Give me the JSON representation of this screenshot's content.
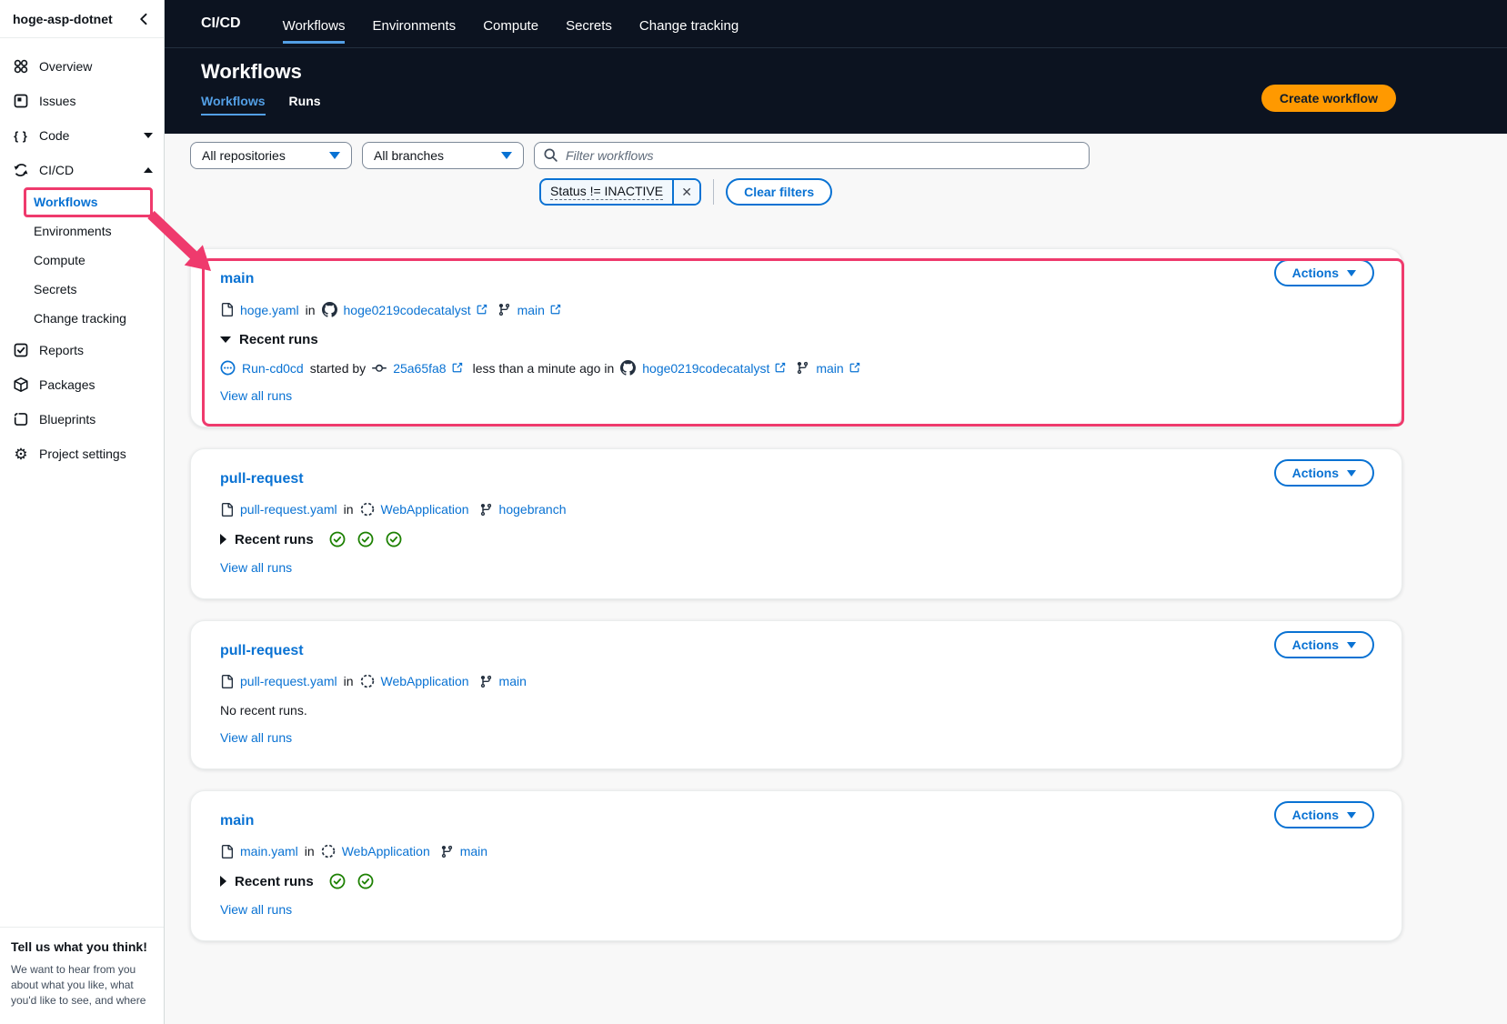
{
  "colors": {
    "accent_blue": "#0972d3",
    "active_tab_blue": "#539fe5",
    "dark_nav": "#0c1320",
    "primary_orange": "#ff9900",
    "success_green": "#1d8102",
    "annotation_pink": "#ef3a6d"
  },
  "icons": {
    "collapse": "chevron-left",
    "dropdown_caret": "filled-triangle-down",
    "token_close": "✕",
    "gear": "⚙",
    "code_braces": "{ }"
  },
  "sidebar": {
    "project_name": "hoge-asp-dotnet",
    "items": [
      "Overview",
      "Issues",
      "Code",
      "CI/CD",
      "Reports",
      "Packages",
      "Blueprints",
      "Project settings"
    ],
    "cicd_children": [
      "Workflows",
      "Environments",
      "Compute",
      "Secrets",
      "Change tracking"
    ],
    "active_child": "Workflows",
    "feedback_title": "Tell us what you think!",
    "feedback_body": "We want to hear from you about what you like, what you'd like to see, and where"
  },
  "topnav": {
    "section": "CI/CD",
    "items": [
      "Workflows",
      "Environments",
      "Compute",
      "Secrets",
      "Change tracking"
    ],
    "active": "Workflows"
  },
  "header": {
    "title": "Workflows",
    "tab_workflows": "Workflows",
    "tab_runs": "Runs",
    "create_button": "Create workflow"
  },
  "filters": {
    "repositories": "All repositories",
    "branches": "All branches",
    "search_placeholder": "Filter workflows",
    "token_label": "Status != INACTIVE",
    "clear_label": "Clear filters"
  },
  "common": {
    "recent_runs": "Recent runs",
    "view_all": "View all runs",
    "actions": "Actions",
    "in": "in",
    "no_recent": "No recent runs."
  },
  "cards": [
    {
      "title": "main",
      "file": "hoge.yaml",
      "repo": "hoge0219codecatalyst",
      "repo_icon": "github-icon",
      "branch": "main",
      "expanded": true,
      "annotated": true,
      "run": {
        "name": "Run-cd0cd",
        "status": "in-progress",
        "started_by": "started by",
        "commit": "25a65fa8",
        "ago": "less than a minute ago in",
        "repo": "hoge0219codecatalyst",
        "branch": "main"
      }
    },
    {
      "title": "pull-request",
      "file": "pull-request.yaml",
      "repo": "WebApplication",
      "repo_icon": "codecatalyst-repo-icon",
      "branch": "hogebranch",
      "expanded": false,
      "statuses": [
        "success",
        "success",
        "success"
      ]
    },
    {
      "title": "pull-request",
      "file": "pull-request.yaml",
      "repo": "WebApplication",
      "repo_icon": "codecatalyst-repo-icon",
      "branch": "main",
      "expanded": false,
      "statuses": []
    },
    {
      "title": "main",
      "file": "main.yaml",
      "repo": "WebApplication",
      "repo_icon": "codecatalyst-repo-icon",
      "branch": "main",
      "expanded": false,
      "statuses": [
        "success",
        "success"
      ]
    }
  ]
}
